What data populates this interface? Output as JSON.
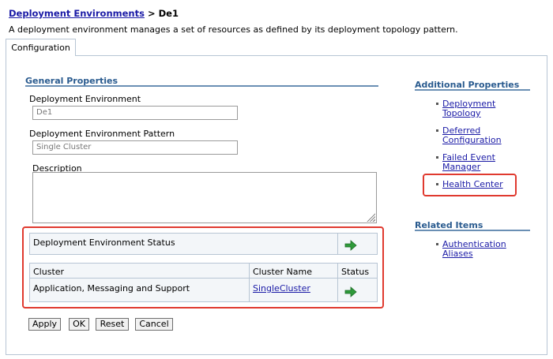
{
  "breadcrumb": {
    "link": "Deployment Environments",
    "separator": " > ",
    "current": "De1"
  },
  "page_description": "A deployment environment manages a set of resources as defined by its deployment topology pattern.",
  "tabs": [
    {
      "label": "Configuration",
      "active": true
    }
  ],
  "general_properties": {
    "title": "General Properties",
    "deployment_environment": {
      "label": "Deployment Environment",
      "value": "De1"
    },
    "pattern": {
      "label": "Deployment Environment Pattern",
      "value": "Single Cluster"
    },
    "description": {
      "label": "Description",
      "value": ""
    }
  },
  "status_section": {
    "env_status_label": "Deployment Environment Status",
    "columns": [
      "Cluster",
      "Cluster Name",
      "Status"
    ],
    "rows": [
      {
        "cluster": "Application, Messaging and Support",
        "cluster_name": "SingleCluster"
      }
    ]
  },
  "buttons": {
    "apply": "Apply",
    "ok": "OK",
    "reset": "Reset",
    "cancel": "Cancel"
  },
  "additional_properties": {
    "title": "Additional Properties",
    "items": [
      {
        "line1": "Deployment",
        "line2": "Topology"
      },
      {
        "line1": "Deferred",
        "line2": "Configuration"
      },
      {
        "line1": "Failed Event",
        "line2": "Manager"
      },
      {
        "line1": "Health Center",
        "line2": ""
      }
    ]
  },
  "related_items": {
    "title": "Related Items",
    "items": [
      {
        "line1": "Authentication",
        "line2": "Aliases"
      }
    ]
  },
  "colors": {
    "link": "#1a1aa6",
    "section_title": "#2a5b8f",
    "highlight": "#e03a2f",
    "arrow": "#2e9a3a"
  }
}
